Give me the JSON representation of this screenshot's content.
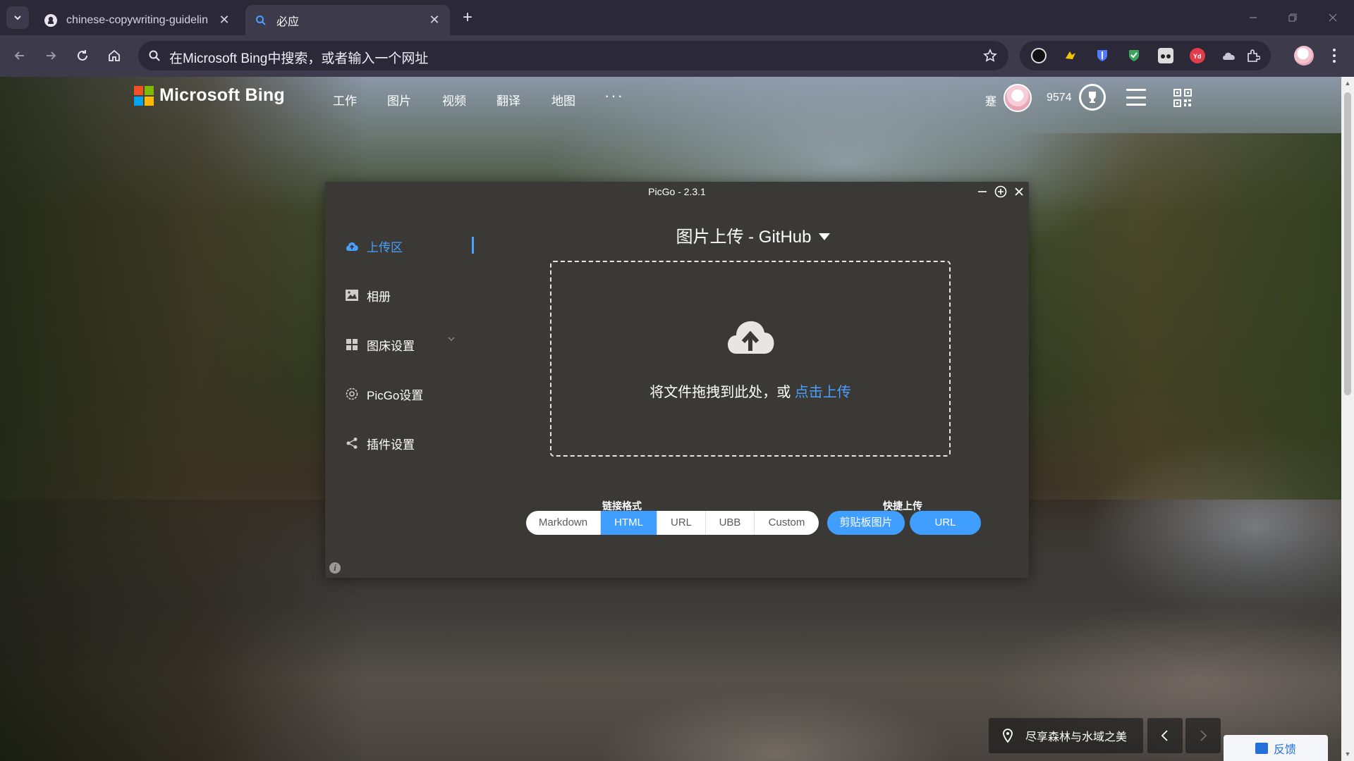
{
  "browser": {
    "tabs": [
      {
        "title": "chinese-copywriting-guidelin",
        "icon": "github-icon"
      },
      {
        "title": "必应",
        "icon": "bing-search-icon"
      }
    ],
    "address_text": "在Microsoft Bing中搜索，或者输入一个网址"
  },
  "bing": {
    "logo_text": "Microsoft Bing",
    "nav": [
      "工作",
      "图片",
      "视频",
      "翻译",
      "地图"
    ],
    "more": "···",
    "user_label": "蹇",
    "points": "9574",
    "caption": "尽享森林与水域之美",
    "feedback": "反馈"
  },
  "picgo": {
    "title": "PicGo - 2.3.1",
    "sidebar": [
      {
        "label": "上传区",
        "icon": "cloud-upload-icon",
        "active": true
      },
      {
        "label": "相册",
        "icon": "picture-icon",
        "active": false
      },
      {
        "label": "图床设置",
        "icon": "grid-icon",
        "active": false
      },
      {
        "label": "PicGo设置",
        "icon": "gear-icon",
        "active": false
      },
      {
        "label": "插件设置",
        "icon": "share-icon",
        "active": false
      }
    ],
    "heading": "图片上传 - GitHub",
    "drop_text": "将文件拖拽到此处，或 ",
    "drop_link": "点击上传",
    "link_format_label": "链接格式",
    "link_formats": [
      "Markdown",
      "HTML",
      "URL",
      "UBB",
      "Custom"
    ],
    "link_format_selected": "HTML",
    "quick_upload_label": "快捷上传",
    "quick_buttons": [
      "剪贴板图片",
      "URL"
    ],
    "info": "i"
  },
  "colors": {
    "accent": "#409eff",
    "picgo_bg": "#3b3936",
    "browser_chrome": "#3d3a4b"
  }
}
